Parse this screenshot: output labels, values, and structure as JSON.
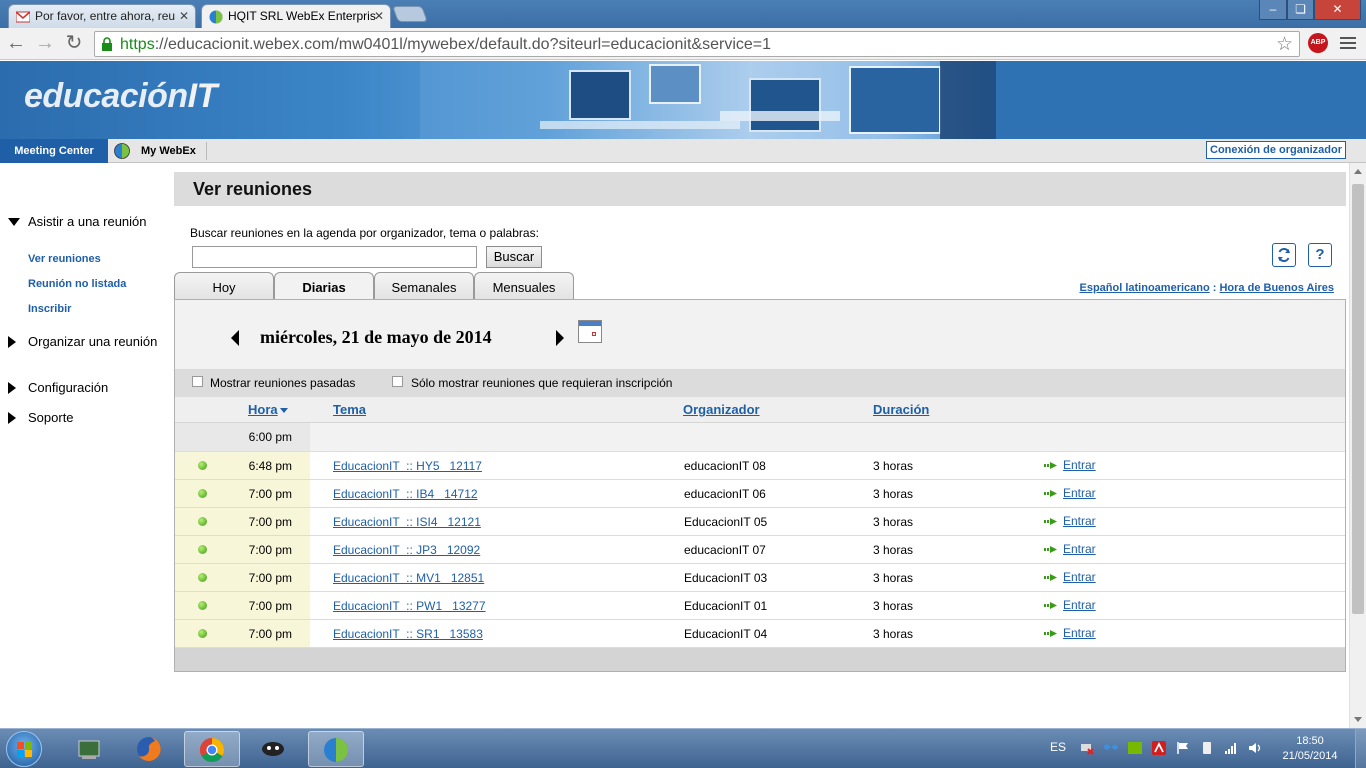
{
  "browser": {
    "tabs": [
      {
        "title": "Por favor, entre ahora, reu",
        "icon": "gmail-icon"
      },
      {
        "title": "HQIT SRL WebEx Enterpris",
        "icon": "webex-icon"
      }
    ],
    "url_scheme": "https",
    "url_rest": "://educacionit.webex.com/mw0401l/mywebex/default.do?siteurl=educacionit&service=1",
    "abp_label": "ABP",
    "window_controls": {
      "minimize": "–",
      "restore": "❏",
      "close": "✕"
    }
  },
  "banner": {
    "logo_text": "educación",
    "logo_it": "IT"
  },
  "topnav": {
    "meeting_center": "Meeting Center",
    "my_webex": "My WebEx",
    "host_login": "Conexión de organizador"
  },
  "sidebar": {
    "groups": [
      {
        "label": "Asistir a una reunión",
        "expanded": true,
        "links": [
          "Ver reuniones",
          "Reunión no listada",
          "Inscribir"
        ]
      },
      {
        "label": "Organizar una reunión",
        "expanded": false
      },
      {
        "label": "Configuración",
        "expanded": false
      },
      {
        "label": "Soporte",
        "expanded": false
      }
    ]
  },
  "main": {
    "title": "Ver reuniones",
    "search_label": "Buscar reuniones en la agenda por organizador, tema o palabras:",
    "search_value": "",
    "search_button": "Buscar",
    "refresh_icon": "refresh-icon",
    "help_icon": "help-icon",
    "help_label": "?",
    "tabs": [
      "Hoy",
      "Diarias",
      "Semanales",
      "Mensuales"
    ],
    "active_tab": "Diarias",
    "language_link": "Español latinoamericano",
    "lang_sep": " : ",
    "timezone_link": "Hora de Buenos Aires",
    "date": "miércoles, 21 de mayo de 2014",
    "filters": {
      "past": "Mostrar reuniones pasadas",
      "registration": "Sólo mostrar reuniones que requieran inscripción"
    },
    "columns": {
      "time": "Hora",
      "topic": "Tema",
      "host": "Organizador",
      "duration": "Duración"
    },
    "group_time": "6:00 pm",
    "meetings": [
      {
        "time": "6:48 pm",
        "topic": "EducacionIT  :: HY5   12117",
        "host": "educacionIT 08",
        "duration": "3 horas",
        "action": "Entrar"
      },
      {
        "time": "7:00 pm",
        "topic": "EducacionIT  :: IB4   14712",
        "host": "educacionIT 06",
        "duration": "3 horas",
        "action": "Entrar"
      },
      {
        "time": "7:00 pm",
        "topic": "EducacionIT  :: ISI4   12121",
        "host": "EducacionIT 05",
        "duration": "3 horas",
        "action": "Entrar"
      },
      {
        "time": "7:00 pm",
        "topic": "EducacionIT  :: JP3   12092",
        "host": "educacionIT 07",
        "duration": "3 horas",
        "action": "Entrar"
      },
      {
        "time": "7:00 pm",
        "topic": "EducacionIT  :: MV1   12851",
        "host": "EducacionIT 03",
        "duration": "3 horas",
        "action": "Entrar"
      },
      {
        "time": "7:00 pm",
        "topic": "EducacionIT  :: PW1   13277",
        "host": "EducacionIT 01",
        "duration": "3 horas",
        "action": "Entrar"
      },
      {
        "time": "7:00 pm",
        "topic": "EducacionIT  :: SR1   13583",
        "host": "EducacionIT 04",
        "duration": "3 horas",
        "action": "Entrar"
      }
    ]
  },
  "taskbar": {
    "apps": [
      "explorer-icon",
      "firefox-icon",
      "chrome-icon",
      "app-icon",
      "webex-icon"
    ],
    "language": "ES",
    "time": "18:50",
    "date": "21/05/2014"
  },
  "colors": {
    "accent": "#1e5fa8",
    "banner": "#2a6aab",
    "status_green": "#3b9a1a"
  }
}
